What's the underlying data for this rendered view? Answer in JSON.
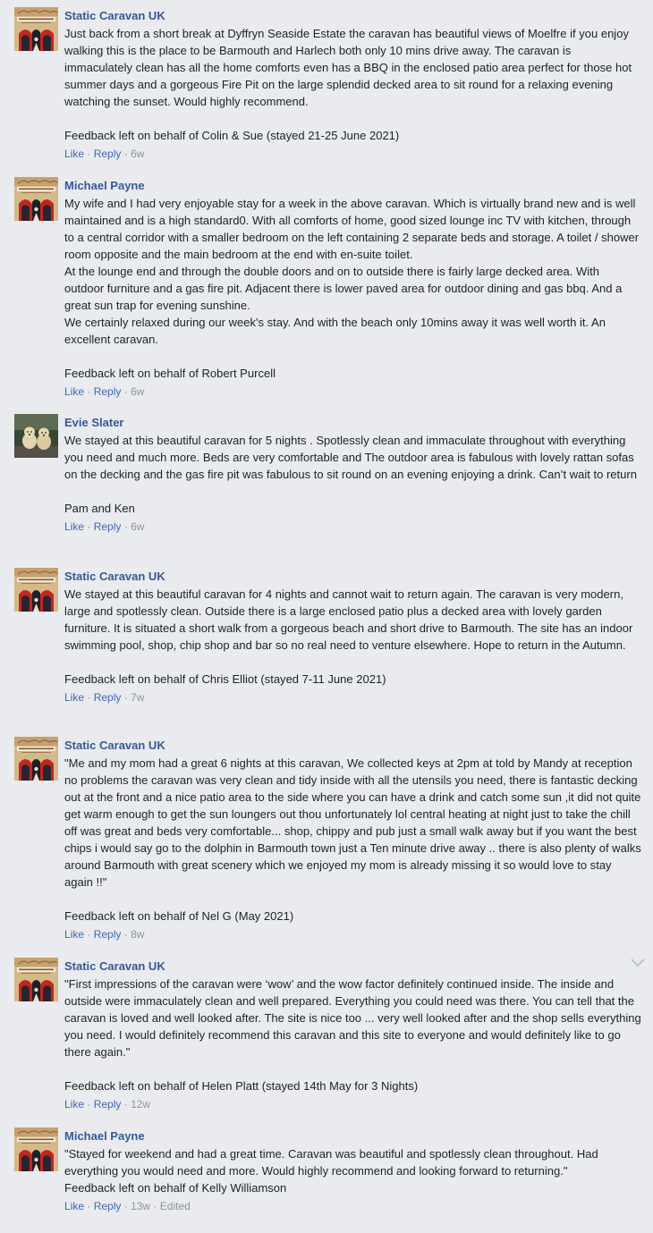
{
  "colors": {
    "background": "#e9ebee",
    "author_link": "#385898",
    "action_link": "#4267b2",
    "meta_text": "#90949c",
    "body_text": "#1d2129"
  },
  "actions": {
    "like": "Like",
    "reply": "Reply",
    "dot": "·"
  },
  "comments": [
    {
      "author": "Static Caravan UK",
      "avatar": "static-caravan-uk-logo",
      "text": "Just back from a short break at Dyffryn Seaside Estate the caravan has beautiful views of Moelfre if you enjoy walking this is the place to be Barmouth and Harlech both only 10 mins drive away. The caravan is immaculately clean has all the home comforts even has a BBQ in the enclosed patio area perfect for those hot summer days and a gorgeous Fire Pit on the large splendid decked area to sit round for a relaxing evening watching the sunset. Would highly recommend.\n\nFeedback left on behalf of Colin & Sue (stayed 21-25 June 2021)",
      "time": "6w",
      "edited": ""
    },
    {
      "author": "Michael Payne",
      "avatar": "static-caravan-uk-logo",
      "text": "My wife and I had very enjoyable stay for a week in the above caravan. Which is virtually brand new and is well maintained and is a high standard0. With all comforts of home, good sized lounge inc TV with kitchen, through to a central corridor with a smaller bedroom on the left containing 2 separate beds and storage. A toilet / shower room opposite and the main bedroom at the end with en-suite toilet.\nAt the lounge end and through the double doors and on to outside there is fairly large decked area. With outdoor furniture and a gas fire pit. Adjacent there is lower paved area for outdoor dining and gas bbq. And a great sun trap for evening sunshine.\nWe certainly relaxed during our week's stay. And with the beach only 10mins away it was well worth it. An excellent caravan.\n\nFeedback left on behalf of Robert Purcell",
      "time": "6w",
      "edited": ""
    },
    {
      "author": "Evie Slater",
      "avatar": "dogs-photo",
      "text": "We stayed at this beautiful caravan for 5 nights . Spotlessly clean and immaculate throughout with everything you need and much more. Beds are very comfortable and The outdoor area is fabulous with lovely rattan sofas on the decking and the gas fire pit was fabulous to sit round on an evening enjoying a drink. Can’t wait to return\n\nPam and Ken",
      "time": "6w",
      "edited": ""
    },
    {
      "author": "Static Caravan UK",
      "avatar": "static-caravan-uk-logo",
      "text": "We stayed at this beautiful caravan for 4 nights and cannot wait to return again. The caravan is very modern, large and spotlessly clean. Outside there is a large enclosed patio plus a decked area with lovely garden furniture. It is situated a short walk from a gorgeous beach and short drive to Barmouth. The site has an indoor swimming pool, shop, chip shop and bar so no real need to venture elsewhere. Hope to return in the Autumn.\n\nFeedback left on behalf of Chris Elliot (stayed 7-11 June 2021)",
      "time": "7w",
      "edited": ""
    },
    {
      "author": "Static Caravan UK",
      "avatar": "static-caravan-uk-logo",
      "text": "\"Me and my mom had a great 6 nights at this caravan, We collected keys at 2pm at told by Mandy at reception no problems the caravan was very clean and tidy inside with all the utensils you need, there is fantastic decking out at the front and a nice patio area to the side where you can have a drink and catch some sun ,it did not quite get warm enough to get the sun loungers out thou unfortunately lol central heating at night just to take the chill off was great and beds very comfortable... shop, chippy and pub just a small walk away but if you want the best chips i would say go to the dolphin in Barmouth town just a Ten minute drive away .. there is also plenty of walks around Barmouth with great scenery which we enjoyed my mom is already missing it so would love to stay again !!\"\n\nFeedback left on behalf of Nel G (May 2021)",
      "time": "8w",
      "edited": ""
    },
    {
      "author": "Static Caravan UK",
      "avatar": "static-caravan-uk-logo",
      "text": "\"First impressions of the caravan were ‘wow’ and the wow factor definitely continued inside. The inside and outside were immaculately clean and well prepared. Everything you could need was there. You can tell that the caravan is loved and well looked after. The site is nice too ... very well looked after and the shop sells everything you need. I would definitely recommend this caravan and this site to everyone and would definitely like to go there again.\"\n\nFeedback left on behalf of Helen Platt (stayed 14th May for 3 Nights)",
      "time": "12w",
      "edited": "",
      "has_menu": true
    },
    {
      "author": "Michael Payne",
      "avatar": "static-caravan-uk-logo",
      "text": "\"Stayed for weekend and had a great time. Caravan was beautiful and spotlessly clean throughout. Had everything you would need and more. Would highly recommend and looking forward to returning.\"\nFeedback left on behalf of Kelly Williamson",
      "time": "13w",
      "edited": "Edited"
    }
  ]
}
